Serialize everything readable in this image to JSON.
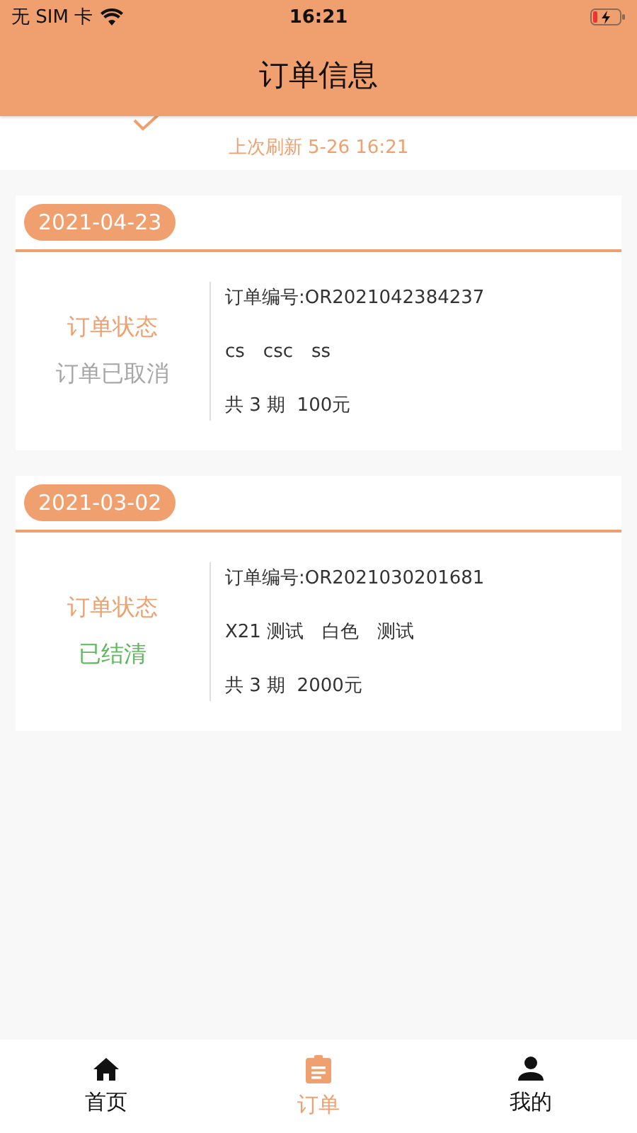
{
  "status_bar": {
    "carrier": "无 SIM 卡",
    "time": "16:21"
  },
  "nav_bar": {
    "title": "订单信息"
  },
  "refresh": {
    "last_refresh": "上次刷新 5-26 16:21"
  },
  "orders": [
    {
      "date": "2021-04-23",
      "status_label": "订单状态",
      "status": {
        "text": "订单已取消",
        "color": "#a6a6a6"
      },
      "order_no": "订单编号:OR2021042384237",
      "items": "cs　csc　ss",
      "total": "共 3 期  100元"
    },
    {
      "date": "2021-03-02",
      "status_label": "订单状态",
      "status": {
        "text": "已结清",
        "color": "#5cb85c"
      },
      "order_no": "订单编号:OR2021030201681",
      "items": "X21 测试　白色　测试",
      "total": "共 3 期  2000元"
    }
  ],
  "tab_bar": [
    {
      "label": "首页",
      "kind": "home",
      "selected": false
    },
    {
      "label": "订单",
      "kind": "orders",
      "selected": true
    },
    {
      "label": "我的",
      "kind": "profile",
      "selected": false
    }
  ]
}
